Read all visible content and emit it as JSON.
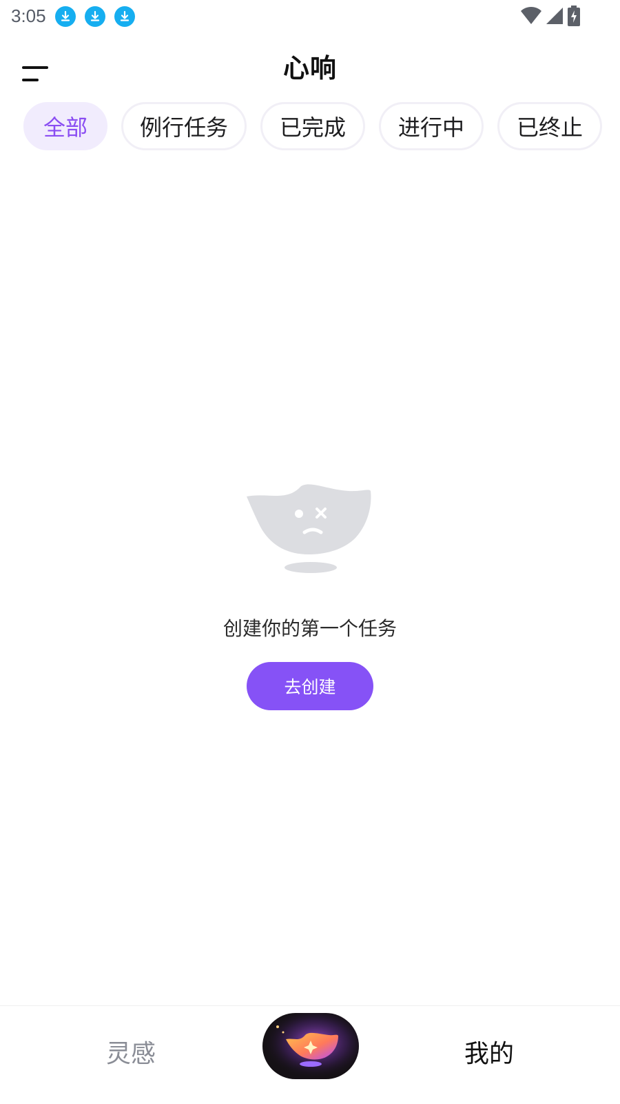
{
  "status_bar": {
    "time": "3:05",
    "notification_icons": [
      "download-icon",
      "download-icon",
      "download-icon"
    ],
    "system_icons": [
      "wifi-icon",
      "signal-icon",
      "battery-charging-icon"
    ]
  },
  "header": {
    "title": "心响",
    "menu_icon": "menu-icon"
  },
  "filter_tabs": [
    {
      "label": "全部",
      "active": true
    },
    {
      "label": "例行任务",
      "active": false
    },
    {
      "label": "已完成",
      "active": false
    },
    {
      "label": "进行中",
      "active": false
    },
    {
      "label": "已终止",
      "active": false
    }
  ],
  "empty_state": {
    "icon": "sad-bowl-icon",
    "message": "创建你的第一个任务",
    "button_label": "去创建"
  },
  "bottom_nav": {
    "left_label": "灵感",
    "center_icon": "sparkle-bowl-icon",
    "right_label": "我的"
  },
  "colors": {
    "accent": "#8652f6",
    "active_chip_bg": "#f1ecfd",
    "active_chip_text": "#8a4df2",
    "download_icon": "#16aef0",
    "illustration_gray": "#dcdde1"
  }
}
